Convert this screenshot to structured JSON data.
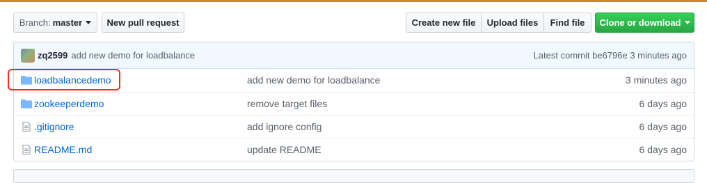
{
  "toolbar": {
    "branch_label": "Branch:",
    "branch_value": "master",
    "new_pull_request": "New pull request",
    "create_new_file": "Create new file",
    "upload_files": "Upload files",
    "find_file": "Find file",
    "clone_or_download": "Clone or download"
  },
  "commit": {
    "author": "zq2599",
    "message": "add new demo for loadbalance",
    "latest": "Latest commit be6796e 3 minutes ago"
  },
  "files": [
    {
      "name": "loadbalancedemo",
      "type": "folder",
      "message": "add new demo for loadbalance",
      "age": "3 minutes ago"
    },
    {
      "name": "zookeeperdemo",
      "type": "folder",
      "message": "remove target files",
      "age": "6 days ago"
    },
    {
      "name": ".gitignore",
      "type": "file",
      "message": "add ignore config",
      "age": "6 days ago"
    },
    {
      "name": "README.md",
      "type": "file",
      "message": "update README",
      "age": "6 days ago"
    }
  ],
  "colors": {
    "link": "#0366d6",
    "clone_button": "#28a745",
    "highlight": "#ff2525",
    "commit_bar": "#f1f8ff"
  },
  "icons": [
    "folder-icon",
    "file-icon",
    "caret-down-icon"
  ]
}
